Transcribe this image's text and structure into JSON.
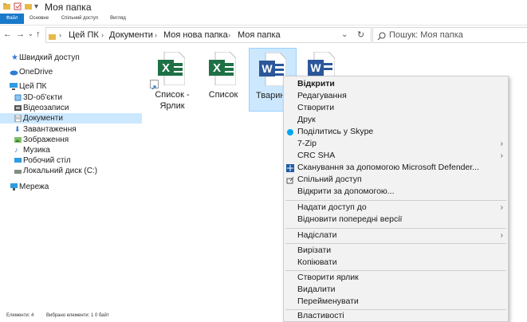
{
  "window": {
    "title": "Моя папка"
  },
  "ribbon": {
    "tabs": [
      {
        "label": "Файл"
      },
      {
        "label": "Основне"
      },
      {
        "label": "Спільний доступ"
      },
      {
        "label": "Вигляд"
      }
    ]
  },
  "address": {
    "crumbs": [
      "Цей ПК",
      "Документи",
      "Моя нова папка",
      "Моя папка"
    ],
    "search_placeholder": "Пошук: Моя папка"
  },
  "sidebar": {
    "items": [
      {
        "label": "Швидкий доступ",
        "icon": "star-icon"
      },
      {
        "label": "OneDrive",
        "icon": "cloud-icon"
      },
      {
        "label": "Цей ПК",
        "icon": "computer-icon"
      },
      {
        "label": "3D-об'єкти",
        "icon": "cube-icon"
      },
      {
        "label": "Відеозаписи",
        "icon": "video-icon"
      },
      {
        "label": "Документи",
        "icon": "documents-icon"
      },
      {
        "label": "Завантаження",
        "icon": "download-icon"
      },
      {
        "label": "Зображення",
        "icon": "pictures-icon"
      },
      {
        "label": "Музика",
        "icon": "music-icon"
      },
      {
        "label": "Робочий стіл",
        "icon": "desktop-icon"
      },
      {
        "label": "Локальний диск (C:)",
        "icon": "drive-icon"
      },
      {
        "label": "Мережа",
        "icon": "network-icon"
      }
    ]
  },
  "files": [
    {
      "name": "Список - Ярлик",
      "type": "excel",
      "badge": "X",
      "shortcut": true
    },
    {
      "name": "Список",
      "type": "excel",
      "badge": "X",
      "shortcut": false
    },
    {
      "name": "Тварин",
      "type": "word",
      "badge": "W",
      "shortcut": false
    },
    {
      "name": "",
      "type": "word",
      "badge": "W",
      "shortcut": false
    }
  ],
  "context_menu": {
    "items": [
      {
        "label": "Відкрити"
      },
      {
        "label": "Редагування"
      },
      {
        "label": "Створити"
      },
      {
        "label": "Друк"
      },
      {
        "label": "Поділитись у Skype"
      },
      {
        "label": "7-Zip"
      },
      {
        "label": "CRC SHA"
      },
      {
        "label": "Сканування за допомогою Microsoft Defender..."
      },
      {
        "label": "Спільний доступ"
      },
      {
        "label": "Відкрити за допомогою..."
      },
      {
        "label": "Надати доступ до"
      },
      {
        "label": "Відновити попередні версії"
      },
      {
        "label": "Надіслати"
      },
      {
        "label": "Вирізати"
      },
      {
        "label": "Копіювати"
      },
      {
        "label": "Створити ярлик"
      },
      {
        "label": "Видалити"
      },
      {
        "label": "Перейменувати"
      },
      {
        "label": "Властивості"
      }
    ]
  },
  "status": {
    "count": "Елементи: 4",
    "selected": "Вибрано елементи: 1  0 байт"
  },
  "colors": {
    "accent": "#1979ca",
    "selection": "#cce8ff",
    "excel": "#1e7145",
    "word": "#2b579a",
    "folder": "#e8b94a"
  }
}
